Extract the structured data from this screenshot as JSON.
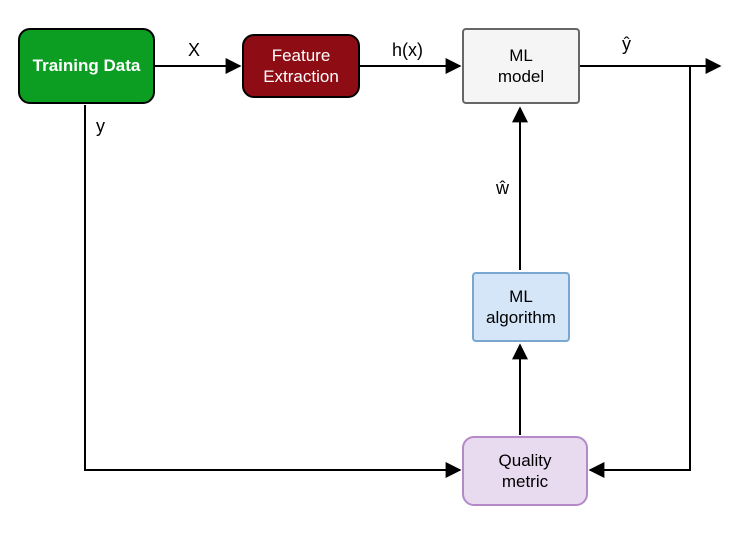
{
  "nodes": {
    "training_data": {
      "label": "Training Data",
      "fill": "#0B9E22",
      "stroke": "#000000",
      "textColor": "#FFFFFF",
      "fontWeight": "bold"
    },
    "feature_extraction": {
      "label": "Feature\nExtraction",
      "fill": "#8E0C13",
      "stroke": "#000000",
      "textColor": "#FFFFFF",
      "fontWeight": "normal"
    },
    "ml_model": {
      "label": "ML\nmodel",
      "fill": "#F5F5F5",
      "stroke": "#666666",
      "textColor": "#000000",
      "fontWeight": "normal"
    },
    "ml_algorithm": {
      "label": "ML\nalgorithm",
      "fill": "#D4E6F8",
      "stroke": "#7AA7D2",
      "textColor": "#000000",
      "fontWeight": "normal"
    },
    "quality_metric": {
      "label": "Quality\nmetric",
      "fill": "#E8DAEF",
      "stroke": "#B489C8",
      "textColor": "#000000",
      "fontWeight": "normal"
    }
  },
  "edges": {
    "x": "X",
    "hx": "h(x)",
    "yhat": "ŷ",
    "y": "y",
    "what": "ŵ"
  }
}
